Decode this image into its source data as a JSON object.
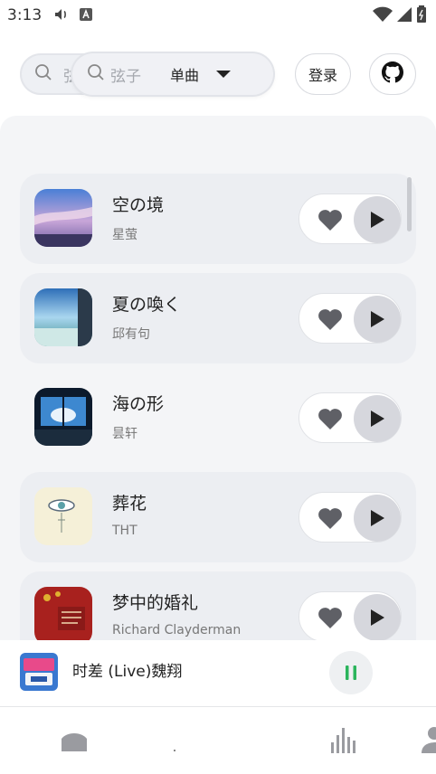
{
  "status_bar": {
    "time": "3:13"
  },
  "search": {
    "back_placeholder": "弦",
    "placeholder": "弦子",
    "type_label": "单曲"
  },
  "header": {
    "login_label": "登录"
  },
  "songs": [
    {
      "title": "空の境",
      "artist": "星萤"
    },
    {
      "title": "夏の喚く",
      "artist": "邱有句"
    },
    {
      "title": "海の形",
      "artist": "昙轩"
    },
    {
      "title": "葬花",
      "artist": "THT"
    },
    {
      "title": "梦中的婚礼",
      "artist": "Richard Clayderman"
    }
  ],
  "now_playing": {
    "title": "时差 (Live)魏翔"
  },
  "colors": {
    "accent_green": "#2bb55c",
    "panel_bg": "#f4f5f7",
    "row_shade": "#eceef2"
  }
}
